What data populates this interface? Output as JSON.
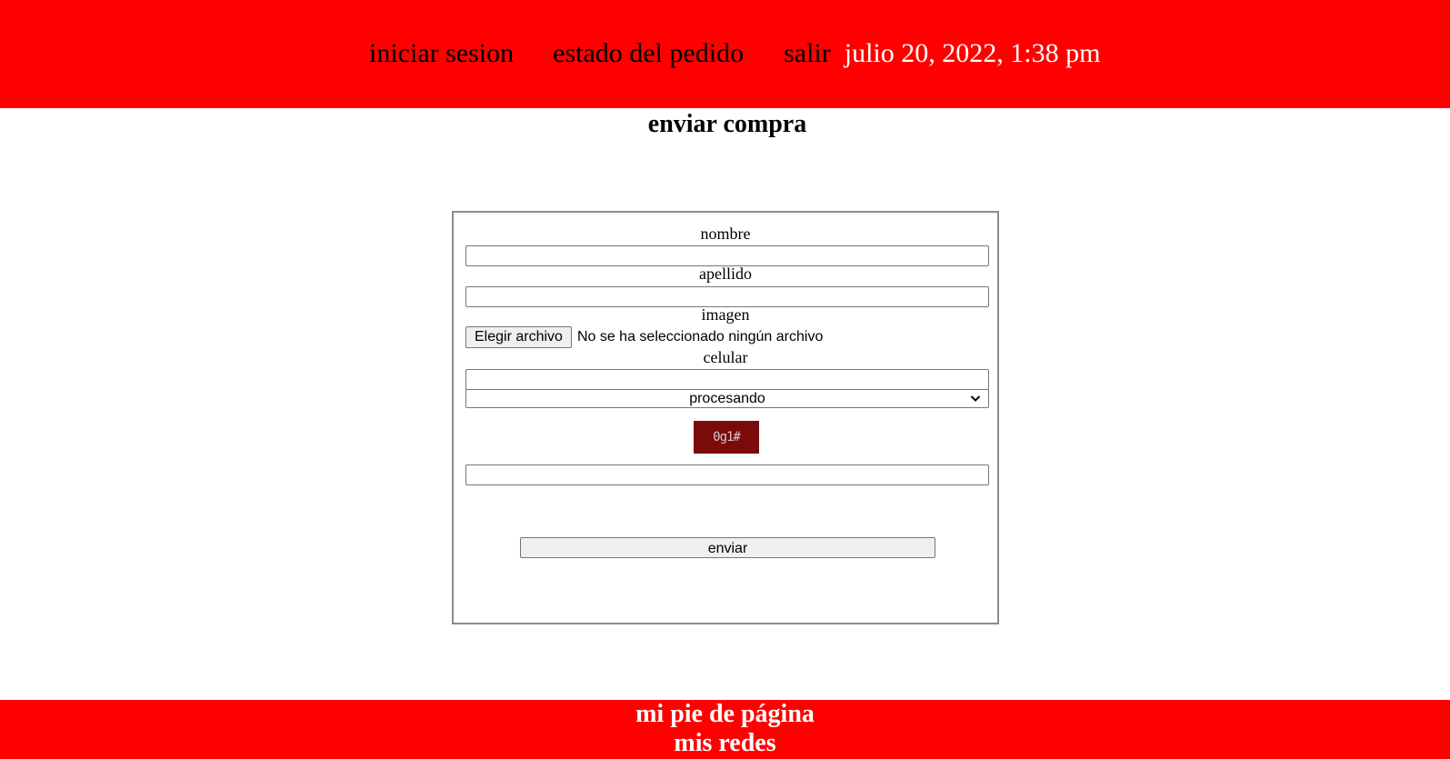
{
  "header": {
    "nav": {
      "login": "iniciar sesion",
      "order_status": "estado del pedido",
      "logout": "salir"
    },
    "datetime": "julio 20, 2022, 1:38 pm"
  },
  "page_title": "enviar compra",
  "form": {
    "nombre_label": "nombre",
    "nombre_value": "",
    "apellido_label": "apellido",
    "apellido_value": "",
    "imagen_label": "imagen",
    "file_button": "Elegir archivo",
    "file_status": "No se ha seleccionado ningún archivo",
    "celular_label": "celular",
    "celular_value": "",
    "status_select": "procesando",
    "captcha_text": "0g1#",
    "captcha_value": "",
    "submit_label": "enviar"
  },
  "footer": {
    "line1": "mi pie de página",
    "line2": "mis redes"
  },
  "colors": {
    "header_bg": "#ff0000",
    "footer_bg": "#ff0000",
    "captcha_bg": "#7a0b0b"
  }
}
